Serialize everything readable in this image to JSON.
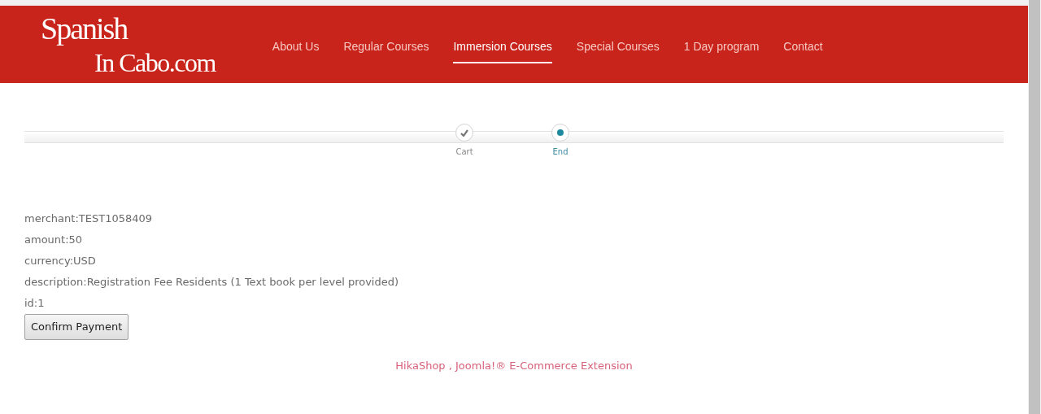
{
  "logo": {
    "line_1": "Spanish",
    "line_2": "In Cabo.com"
  },
  "nav": [
    {
      "label": "About Us",
      "selected": false
    },
    {
      "label": "Regular Courses",
      "selected": false
    },
    {
      "label": "Immersion Courses",
      "selected": true
    },
    {
      "label": "Special Courses",
      "selected": false
    },
    {
      "label": "1 Day program",
      "selected": false
    },
    {
      "label": "Contact",
      "selected": false
    }
  ],
  "steps": [
    {
      "label": "Cart",
      "done": true,
      "selected": false
    },
    {
      "label": "End",
      "done": false,
      "selected": true
    }
  ],
  "details": [
    "merchant:TEST1058409",
    "amount:50",
    "currency:USD",
    "description:Registration Fee Residents (1 Text book per level provided)",
    "id:1"
  ],
  "confirm_button": "Confirm Payment",
  "footer_link": "HikaShop , Joomla!® E-Commerce Extension"
}
